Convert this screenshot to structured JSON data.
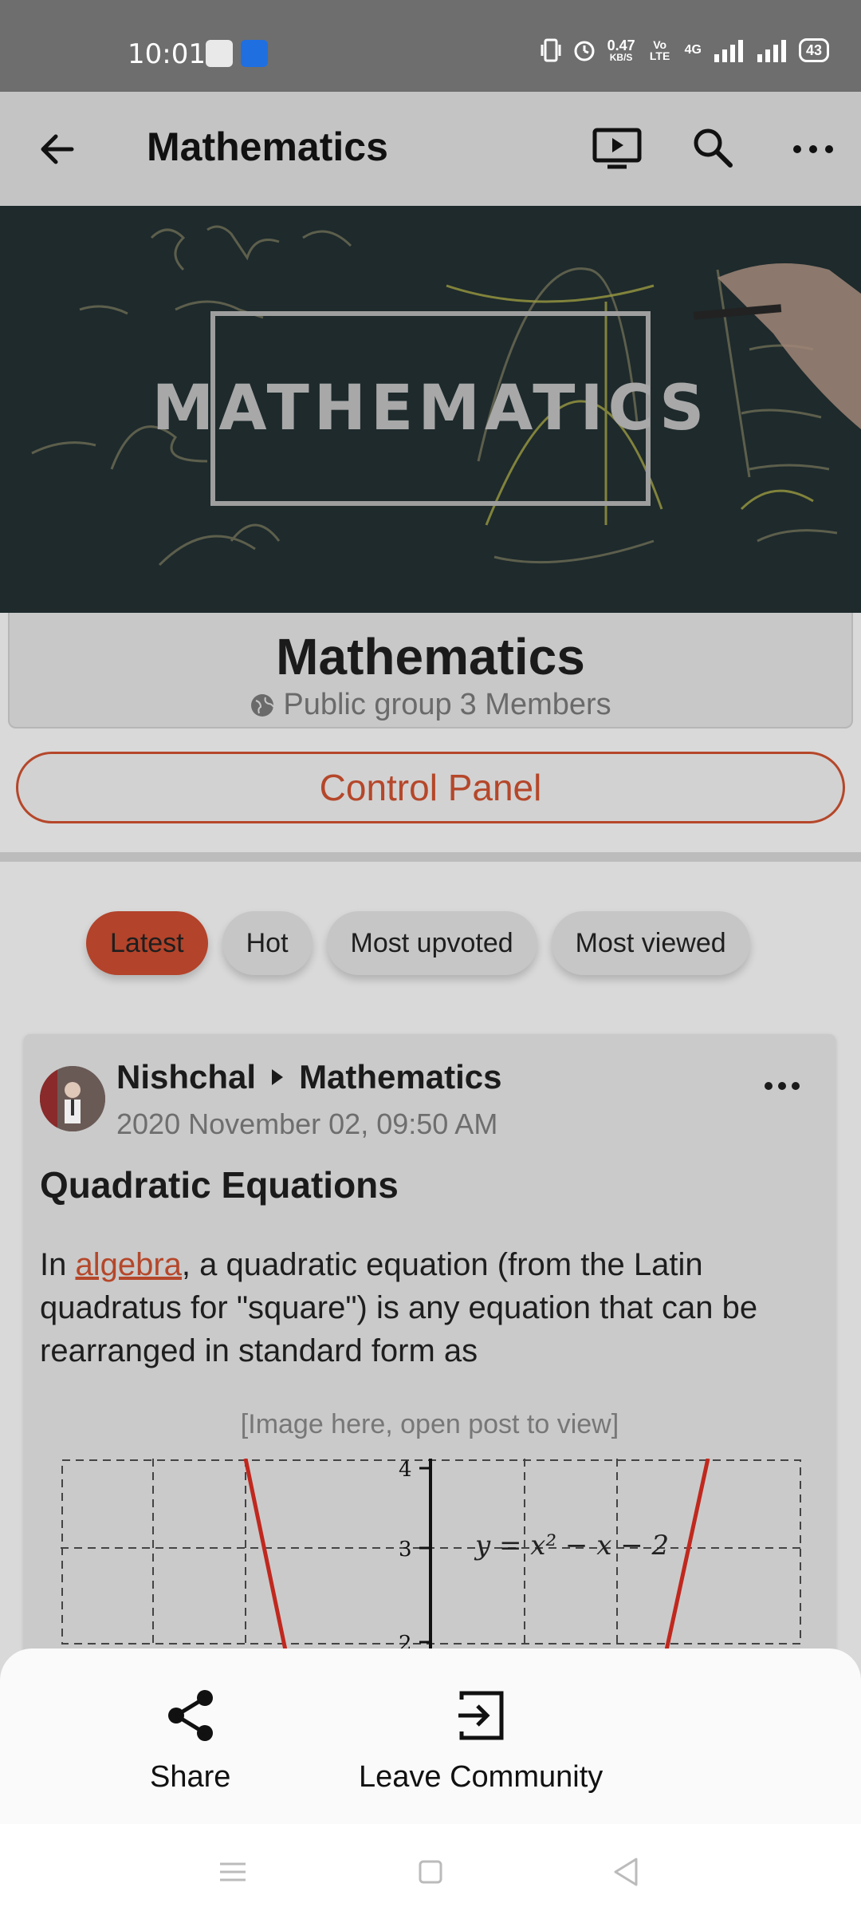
{
  "status_bar": {
    "time": "10:01",
    "speed_value": "0.47",
    "speed_unit": "KB/S",
    "volte": "Vo LTE",
    "network": "4G",
    "battery": "43"
  },
  "app_bar": {
    "title": "Mathematics"
  },
  "banner": {
    "text": "MATHEMATICS"
  },
  "group": {
    "name": "Mathematics",
    "privacy": "Public group",
    "members": "3 Members",
    "control_panel_label": "Control Panel"
  },
  "tabs": [
    {
      "label": "Latest",
      "active": true
    },
    {
      "label": "Hot",
      "active": false
    },
    {
      "label": "Most upvoted",
      "active": false
    },
    {
      "label": "Most viewed",
      "active": false
    }
  ],
  "post": {
    "author": "Nishchal",
    "community": "Mathematics",
    "date": "2020 November 02, 09:50 AM",
    "title": "Quadratic Equations",
    "body_prefix": "In ",
    "body_link": "algebra",
    "body_suffix": ", a quadratic equation (from the Latin quadratus for \"square\") is any equation that can be rearranged in standard form as",
    "image_note": "[Image here, open post to view]",
    "graph_equation": "y = x² − x − 2",
    "graph_ticks": [
      "4",
      "3",
      "2"
    ]
  },
  "sheet": {
    "share_label": "Share",
    "leave_label": "Leave Community"
  },
  "colors": {
    "accent": "#b5472a",
    "graph_line": "#c0281e"
  }
}
